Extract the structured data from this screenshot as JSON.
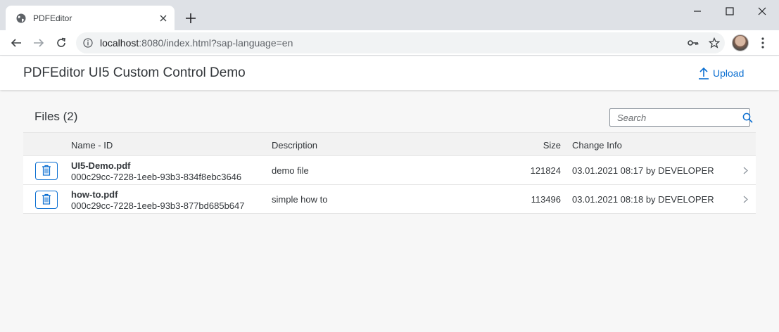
{
  "browser": {
    "tab_title": "PDFEditor",
    "url_host": "localhost",
    "url_rest": ":8080/index.html?sap-language=en"
  },
  "app": {
    "title": "PDFEditor UI5 Custom Control Demo",
    "upload_label": "Upload"
  },
  "files": {
    "title": "Files (2)",
    "search_placeholder": "Search",
    "columns": {
      "name": "Name - ID",
      "description": "Description",
      "size": "Size",
      "change": "Change Info"
    },
    "rows": [
      {
        "name": "UI5-Demo.pdf",
        "id": "000c29cc-7228-1eeb-93b3-834f8ebc3646",
        "description": "demo file",
        "size": "121824",
        "change": "03.01.2021 08:17 by DEVELOPER"
      },
      {
        "name": "how-to.pdf",
        "id": "000c29cc-7228-1eeb-93b3-877bd685b647",
        "description": "simple how to",
        "size": "113496",
        "change": "03.01.2021 08:18 by DEVELOPER"
      }
    ]
  },
  "colors": {
    "accent": "#0a6ed1",
    "text": "#32363a",
    "background": "#f7f7f7"
  }
}
